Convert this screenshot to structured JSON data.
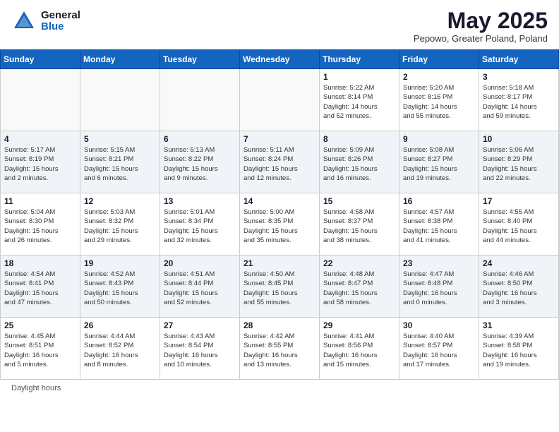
{
  "header": {
    "logo_general": "General",
    "logo_blue": "Blue",
    "title": "May 2025",
    "subtitle": "Pepowo, Greater Poland, Poland"
  },
  "days_of_week": [
    "Sunday",
    "Monday",
    "Tuesday",
    "Wednesday",
    "Thursday",
    "Friday",
    "Saturday"
  ],
  "footer": {
    "note": "Daylight hours"
  },
  "weeks": [
    {
      "alt": false,
      "days": [
        {
          "num": "",
          "info": ""
        },
        {
          "num": "",
          "info": ""
        },
        {
          "num": "",
          "info": ""
        },
        {
          "num": "",
          "info": ""
        },
        {
          "num": "1",
          "info": "Sunrise: 5:22 AM\nSunset: 8:14 PM\nDaylight: 14 hours\nand 52 minutes."
        },
        {
          "num": "2",
          "info": "Sunrise: 5:20 AM\nSunset: 8:16 PM\nDaylight: 14 hours\nand 55 minutes."
        },
        {
          "num": "3",
          "info": "Sunrise: 5:18 AM\nSunset: 8:17 PM\nDaylight: 14 hours\nand 59 minutes."
        }
      ]
    },
    {
      "alt": true,
      "days": [
        {
          "num": "4",
          "info": "Sunrise: 5:17 AM\nSunset: 8:19 PM\nDaylight: 15 hours\nand 2 minutes."
        },
        {
          "num": "5",
          "info": "Sunrise: 5:15 AM\nSunset: 8:21 PM\nDaylight: 15 hours\nand 6 minutes."
        },
        {
          "num": "6",
          "info": "Sunrise: 5:13 AM\nSunset: 8:22 PM\nDaylight: 15 hours\nand 9 minutes."
        },
        {
          "num": "7",
          "info": "Sunrise: 5:11 AM\nSunset: 8:24 PM\nDaylight: 15 hours\nand 12 minutes."
        },
        {
          "num": "8",
          "info": "Sunrise: 5:09 AM\nSunset: 8:26 PM\nDaylight: 15 hours\nand 16 minutes."
        },
        {
          "num": "9",
          "info": "Sunrise: 5:08 AM\nSunset: 8:27 PM\nDaylight: 15 hours\nand 19 minutes."
        },
        {
          "num": "10",
          "info": "Sunrise: 5:06 AM\nSunset: 8:29 PM\nDaylight: 15 hours\nand 22 minutes."
        }
      ]
    },
    {
      "alt": false,
      "days": [
        {
          "num": "11",
          "info": "Sunrise: 5:04 AM\nSunset: 8:30 PM\nDaylight: 15 hours\nand 26 minutes."
        },
        {
          "num": "12",
          "info": "Sunrise: 5:03 AM\nSunset: 8:32 PM\nDaylight: 15 hours\nand 29 minutes."
        },
        {
          "num": "13",
          "info": "Sunrise: 5:01 AM\nSunset: 8:34 PM\nDaylight: 15 hours\nand 32 minutes."
        },
        {
          "num": "14",
          "info": "Sunrise: 5:00 AM\nSunset: 8:35 PM\nDaylight: 15 hours\nand 35 minutes."
        },
        {
          "num": "15",
          "info": "Sunrise: 4:58 AM\nSunset: 8:37 PM\nDaylight: 15 hours\nand 38 minutes."
        },
        {
          "num": "16",
          "info": "Sunrise: 4:57 AM\nSunset: 8:38 PM\nDaylight: 15 hours\nand 41 minutes."
        },
        {
          "num": "17",
          "info": "Sunrise: 4:55 AM\nSunset: 8:40 PM\nDaylight: 15 hours\nand 44 minutes."
        }
      ]
    },
    {
      "alt": true,
      "days": [
        {
          "num": "18",
          "info": "Sunrise: 4:54 AM\nSunset: 8:41 PM\nDaylight: 15 hours\nand 47 minutes."
        },
        {
          "num": "19",
          "info": "Sunrise: 4:52 AM\nSunset: 8:43 PM\nDaylight: 15 hours\nand 50 minutes."
        },
        {
          "num": "20",
          "info": "Sunrise: 4:51 AM\nSunset: 8:44 PM\nDaylight: 15 hours\nand 52 minutes."
        },
        {
          "num": "21",
          "info": "Sunrise: 4:50 AM\nSunset: 8:45 PM\nDaylight: 15 hours\nand 55 minutes."
        },
        {
          "num": "22",
          "info": "Sunrise: 4:48 AM\nSunset: 8:47 PM\nDaylight: 15 hours\nand 58 minutes."
        },
        {
          "num": "23",
          "info": "Sunrise: 4:47 AM\nSunset: 8:48 PM\nDaylight: 16 hours\nand 0 minutes."
        },
        {
          "num": "24",
          "info": "Sunrise: 4:46 AM\nSunset: 8:50 PM\nDaylight: 16 hours\nand 3 minutes."
        }
      ]
    },
    {
      "alt": false,
      "days": [
        {
          "num": "25",
          "info": "Sunrise: 4:45 AM\nSunset: 8:51 PM\nDaylight: 16 hours\nand 5 minutes."
        },
        {
          "num": "26",
          "info": "Sunrise: 4:44 AM\nSunset: 8:52 PM\nDaylight: 16 hours\nand 8 minutes."
        },
        {
          "num": "27",
          "info": "Sunrise: 4:43 AM\nSunset: 8:54 PM\nDaylight: 16 hours\nand 10 minutes."
        },
        {
          "num": "28",
          "info": "Sunrise: 4:42 AM\nSunset: 8:55 PM\nDaylight: 16 hours\nand 13 minutes."
        },
        {
          "num": "29",
          "info": "Sunrise: 4:41 AM\nSunset: 8:56 PM\nDaylight: 16 hours\nand 15 minutes."
        },
        {
          "num": "30",
          "info": "Sunrise: 4:40 AM\nSunset: 8:57 PM\nDaylight: 16 hours\nand 17 minutes."
        },
        {
          "num": "31",
          "info": "Sunrise: 4:39 AM\nSunset: 8:58 PM\nDaylight: 16 hours\nand 19 minutes."
        }
      ]
    }
  ]
}
